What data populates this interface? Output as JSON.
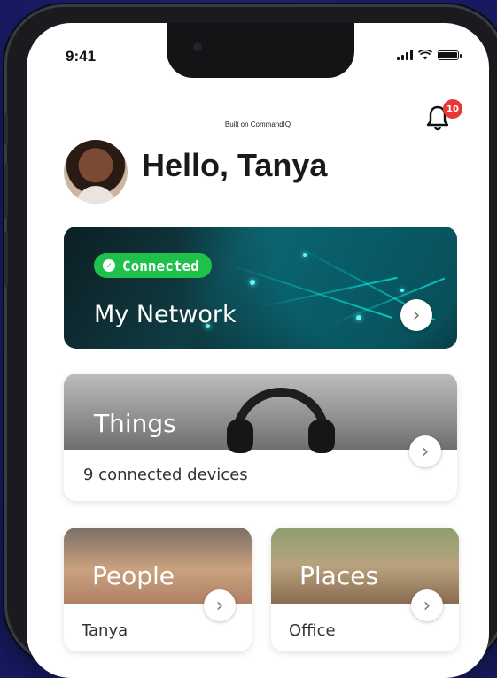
{
  "status_bar": {
    "time": "9:41"
  },
  "notifications": {
    "count": "10"
  },
  "header": {
    "built_on": "Built on CommandIQ",
    "greeting": "Hello, Tanya"
  },
  "network_card": {
    "status_label": "Connected",
    "title": "My Network",
    "status_color": "#1ec24a"
  },
  "things_card": {
    "title": "Things",
    "subtitle": "9 connected devices"
  },
  "people_card": {
    "title": "People",
    "subtitle": "Tanya"
  },
  "places_card": {
    "title": "Places",
    "subtitle": "Office"
  },
  "icons": {
    "bell": "bell-icon",
    "chevron": "chevron-right-icon",
    "check": "check-circle-icon"
  }
}
